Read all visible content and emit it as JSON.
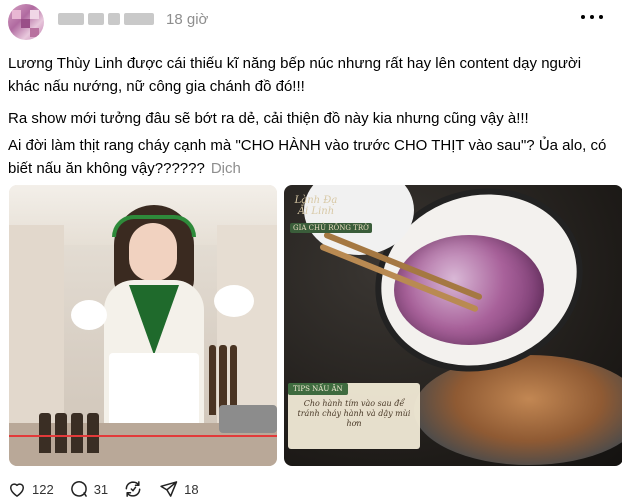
{
  "header": {
    "username": "",
    "time": "18 giờ"
  },
  "post": {
    "p1": "Lương Thùy Linh được cái thiếu kĩ năng bếp núc nhưng rất hay lên content dạy người khác nấu nướng, nữ công gia chánh đồ đó!!!",
    "p2": "Ra show mới tưởng đâu sẽ bớt ra dẻ, cải thiện đồ này kia nhưng cũng vậy à!!!",
    "p3": "Ai đời làm thịt rang cháy cạnh mà \"CHO HÀNH vào trước CHO THỊT vào sau\"? Ủa alo, có biết nấu ăn không vậy??????",
    "translate": "Dịch"
  },
  "media": {
    "image2": {
      "logo": "Lành Đạ Ắi Linh",
      "logo_sub": "GIA CHỦ RÔNG TRỜ",
      "tip_tag": "TIPS NẤU ĂN",
      "tip_text": "Cho hành tím vào sau để tránh cháy hành và dậy mùi hơn"
    }
  },
  "actions": {
    "likes": "122",
    "comments": "31",
    "shares": "18"
  },
  "icons": {
    "more": "more-icon",
    "like": "heart-icon",
    "comment": "comment-icon",
    "repost": "repost-icon",
    "share": "send-icon"
  },
  "colors": {
    "text": "#000000",
    "muted": "#8e8e8e",
    "green_accent": "#3f6b3f"
  }
}
